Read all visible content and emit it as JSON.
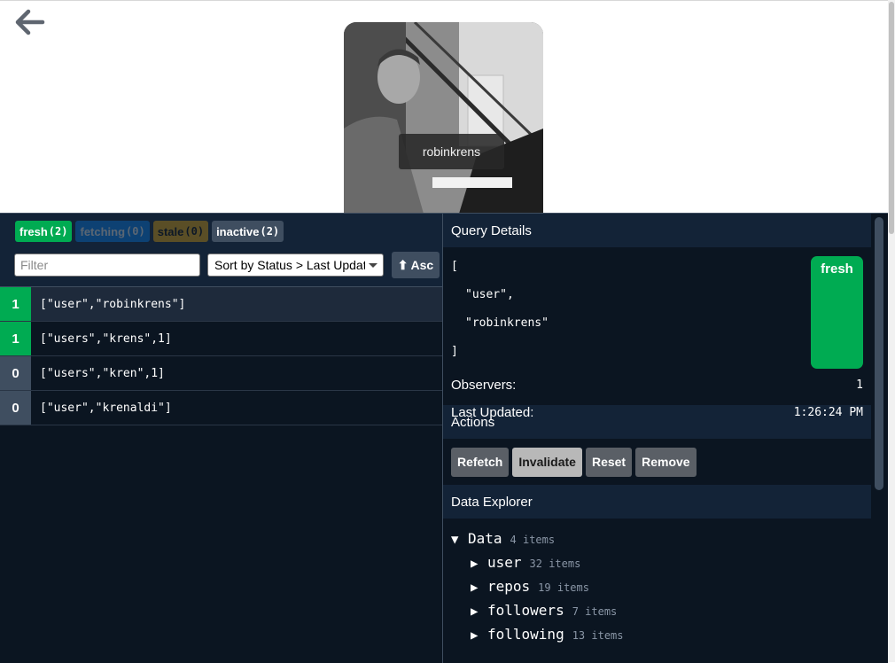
{
  "profile": {
    "username": "robinkrens"
  },
  "devtools": {
    "counts": [
      {
        "label": "fresh",
        "count": "(2)"
      },
      {
        "label": "fetching",
        "count": "(0)"
      },
      {
        "label": "stale",
        "count": "(0)"
      },
      {
        "label": "inactive",
        "count": "(2)"
      }
    ],
    "filter": {
      "placeholder": "Filter",
      "value": ""
    },
    "sort": {
      "selected": "Sort by Status > Last Updated"
    },
    "order_button": {
      "icon": "⬆",
      "label": "Asc"
    },
    "queries": [
      {
        "observers": "1",
        "key": "[\"user\",\"robinkrens\"]",
        "status": "fresh"
      },
      {
        "observers": "1",
        "key": "[\"users\",\"krens\",1]",
        "status": "fresh"
      },
      {
        "observers": "0",
        "key": "[\"users\",\"kren\",1]",
        "status": "inactive"
      },
      {
        "observers": "0",
        "key": "[\"user\",\"krenaldi\"]",
        "status": "inactive"
      }
    ],
    "details": {
      "title": "Query Details",
      "json_lines": [
        "[",
        "\"user\",",
        "\"robinkrens\"",
        "]"
      ],
      "status": "fresh",
      "observers_label": "Observers:",
      "observers_value": "1",
      "updated_label": "Last Updated:",
      "updated_value": "1:26:24 PM"
    },
    "actions": {
      "title": "Actions",
      "buttons": [
        "Refetch",
        "Invalidate",
        "Reset",
        "Remove"
      ]
    },
    "explorer": {
      "title": "Data Explorer",
      "root": {
        "label": "Data",
        "meta": "4 items",
        "arrow": "▼"
      },
      "children": [
        {
          "label": "user",
          "meta": "32 items",
          "arrow": "▶"
        },
        {
          "label": "repos",
          "meta": "19 items",
          "arrow": "▶"
        },
        {
          "label": "followers",
          "meta": "7 items",
          "arrow": "▶"
        },
        {
          "label": "following",
          "meta": "13 items",
          "arrow": "▶"
        }
      ]
    }
  },
  "colors": {
    "fresh": "#00ab52",
    "fetching": "#0088ff",
    "stale": "#ffb200",
    "inactive": "#3f4e60",
    "panel_bg": "#0b1521",
    "header_bg": "#132337"
  }
}
